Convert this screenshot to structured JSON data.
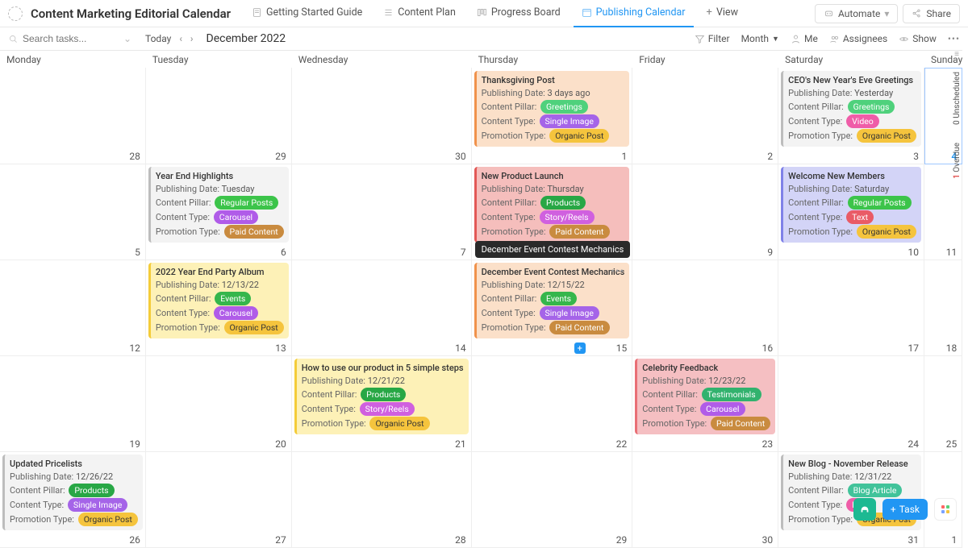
{
  "header": {
    "title": "Content Marketing Editorial Calendar",
    "views": [
      {
        "label": "Getting Started Guide",
        "icon": "doc-icon"
      },
      {
        "label": "Content Plan",
        "icon": "list-icon"
      },
      {
        "label": "Progress Board",
        "icon": "board-icon"
      },
      {
        "label": "Publishing Calendar",
        "icon": "calendar-icon",
        "active": true
      },
      {
        "label": "View",
        "icon": "plus-icon",
        "add": true
      }
    ],
    "automate": "Automate",
    "share": "Share"
  },
  "subbar": {
    "search_placeholder": "Search tasks...",
    "today": "Today",
    "month_label": "December 2022",
    "filter": "Filter",
    "month": "Month",
    "me": "Me",
    "assignees": "Assignees",
    "show": "Show"
  },
  "day_headers": [
    "Monday",
    "Tuesday",
    "Wednesday",
    "Thursday",
    "Friday",
    "Saturday",
    "Sunday"
  ],
  "weeks": [
    [
      {
        "num": "28"
      },
      {
        "num": "29"
      },
      {
        "num": "30"
      },
      {
        "num": "1",
        "cards": [
          {
            "bg": "bg-orange",
            "title": "Thanksgiving Post",
            "pub": "3 days ago",
            "pillar": {
              "t": "Greetings",
              "c": "c-greetings"
            },
            "ctype": {
              "t": "Single Image",
              "c": "c-single"
            },
            "promo": {
              "t": "Organic Post",
              "c": "c-organic"
            }
          }
        ]
      },
      {
        "num": "2"
      },
      {
        "num": "3",
        "cards": [
          {
            "bg": "bg-grey",
            "title": "CEO's New Year's Eve Greetings",
            "pub": "Yesterday",
            "pillar": {
              "t": "Greetings",
              "c": "c-greetings"
            },
            "ctype": {
              "t": "Video",
              "c": "c-video"
            },
            "promo": {
              "t": "Organic Post",
              "c": "c-organic"
            }
          }
        ]
      },
      {
        "num": "4",
        "today": true
      }
    ],
    [
      {
        "num": "5"
      },
      {
        "num": "6",
        "cards": [
          {
            "bg": "bg-grey",
            "title": "Year End Highlights",
            "pub": "Tuesday",
            "pillar": {
              "t": "Regular Posts",
              "c": "c-regular"
            },
            "ctype": {
              "t": "Carousel",
              "c": "c-carousel"
            },
            "promo": {
              "t": "Paid Content",
              "c": "c-paid"
            }
          }
        ]
      },
      {
        "num": "7"
      },
      {
        "num": "8",
        "cards": [
          {
            "bg": "bg-red",
            "title": "New Product Launch",
            "pub": "Thursday",
            "pillar": {
              "t": "Products",
              "c": "c-products"
            },
            "ctype": {
              "t": "Story/Reels",
              "c": "c-story"
            },
            "promo": {
              "t": "Paid Content",
              "c": "c-paid"
            }
          }
        ],
        "tooltip": "December Event Contest Mechanics"
      },
      {
        "num": "9"
      },
      {
        "num": "10",
        "cards": [
          {
            "bg": "bg-purple",
            "title": "Welcome New Members",
            "pub": "Saturday",
            "pillar": {
              "t": "Regular Posts",
              "c": "c-regular"
            },
            "ctype": {
              "t": "Text",
              "c": "c-text"
            },
            "promo": {
              "t": "Organic Post",
              "c": "c-organic"
            }
          }
        ]
      },
      {
        "num": "11"
      }
    ],
    [
      {
        "num": "12"
      },
      {
        "num": "13",
        "cards": [
          {
            "bg": "bg-yellow",
            "title": "2022 Year End Party Album",
            "pub": "12/13/22",
            "pillar": {
              "t": "Events",
              "c": "c-events"
            },
            "ctype": {
              "t": "Carousel",
              "c": "c-carousel"
            },
            "promo": {
              "t": "Organic Post",
              "c": "c-organic"
            }
          }
        ]
      },
      {
        "num": "14"
      },
      {
        "num": "15",
        "cards": [
          {
            "bg": "bg-orange",
            "title": "December Event Contest Mechanics",
            "pub": "12/15/22",
            "pillar": {
              "t": "Events",
              "c": "c-events"
            },
            "ctype": {
              "t": "Single Image",
              "c": "c-single"
            },
            "promo": {
              "t": "Paid Content",
              "c": "c-paid"
            },
            "ellipsis": true
          }
        ],
        "plus": true
      },
      {
        "num": "16"
      },
      {
        "num": "17"
      },
      {
        "num": "18"
      }
    ],
    [
      {
        "num": "19"
      },
      {
        "num": "20"
      },
      {
        "num": "21",
        "cards": [
          {
            "bg": "bg-yellow",
            "title": "How to use our product in 5 simple steps",
            "pub": "12/21/22",
            "pillar": {
              "t": "Products",
              "c": "c-products"
            },
            "ctype": {
              "t": "Story/Reels",
              "c": "c-story"
            },
            "promo": {
              "t": "Organic Post",
              "c": "c-organic"
            }
          }
        ]
      },
      {
        "num": "22"
      },
      {
        "num": "23",
        "cards": [
          {
            "bg": "bg-pink",
            "title": "Celebrity Feedback",
            "pub": "12/23/22",
            "pillar": {
              "t": "Testimonials",
              "c": "c-test"
            },
            "ctype": {
              "t": "Carousel",
              "c": "c-carousel"
            },
            "promo": {
              "t": "Paid Content",
              "c": "c-paid"
            }
          }
        ]
      },
      {
        "num": "24"
      },
      {
        "num": "25"
      }
    ],
    [
      {
        "num": "26",
        "cards": [
          {
            "bg": "bg-grey2",
            "title": "Updated Pricelists",
            "pub": "12/26/22",
            "pillar": {
              "t": "Products",
              "c": "c-products"
            },
            "ctype": {
              "t": "Single Image",
              "c": "c-single"
            },
            "promo": {
              "t": "Organic Post",
              "c": "c-organic"
            }
          }
        ]
      },
      {
        "num": "27"
      },
      {
        "num": "28"
      },
      {
        "num": "29"
      },
      {
        "num": "30"
      },
      {
        "num": "31",
        "cards": [
          {
            "bg": "bg-grey",
            "title": "New Blog - November Release",
            "pub": "12/31/22",
            "pillar": {
              "t": "Blog Article",
              "c": "c-blogart"
            },
            "ctype": {
              "t": "Blog",
              "c": "c-blog"
            },
            "promo": {
              "t": "Organic Post",
              "c": "c-organic"
            }
          }
        ]
      },
      {
        "num": "1"
      }
    ]
  ],
  "card_labels": {
    "pub": "Publishing Date:",
    "pillar": "Content Pillar:",
    "ctype": "Content Type:",
    "promo": "Promotion Type:"
  },
  "rail": {
    "unscheduled_n": "0",
    "unscheduled": "Unscheduled",
    "overdue_n": "1",
    "overdue": "Overdue"
  },
  "fab": {
    "task": "Task"
  }
}
